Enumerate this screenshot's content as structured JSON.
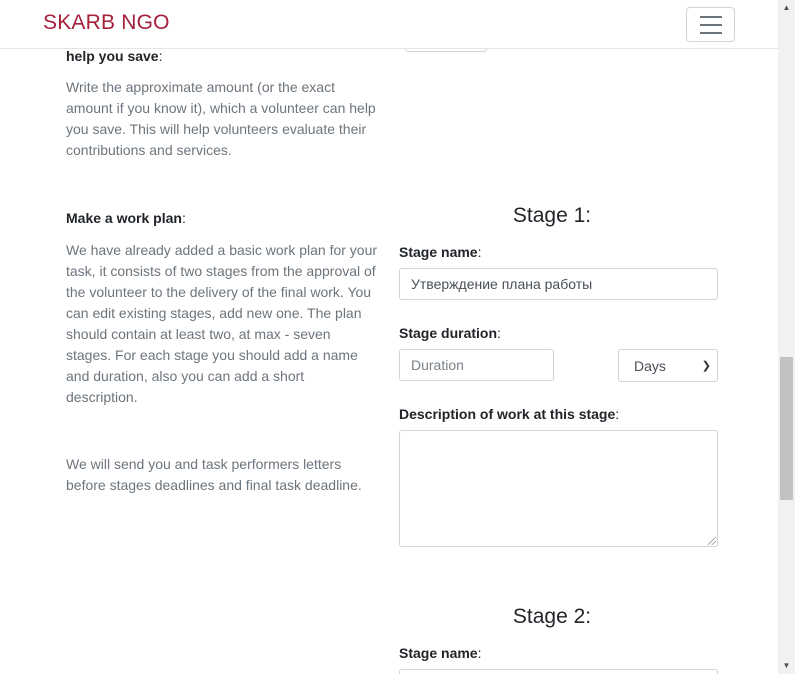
{
  "navbar": {
    "brand": "SKARB NGO",
    "toggle_icon": "hamburger-icon"
  },
  "save_section": {
    "label": "help you save",
    "label_colon": ":",
    "help": "Write the approximate amount (or the exact amount if you know it), which a volunteer can help you save. This will help volunteers evaluate their contributions and services."
  },
  "work_plan": {
    "label": "Make a work plan",
    "label_colon": ":",
    "help": "We have already added a basic work plan for your task, it consists of two stages from the approval of the volunteer to the delivery of the final work. You can edit existing stages, add new one. The plan should contain at least two, at max - seven stages. For each stage you should add a name and duration, also you can add a short description.",
    "note": "We will send you and task performers letters before stages deadlines and final task deadline."
  },
  "stages": [
    {
      "title": "Stage 1:",
      "name_label": "Stage name",
      "name_value": "Утверждение плана работы",
      "duration_label": "Stage duration",
      "duration_placeholder": "Duration",
      "unit_selected": "Days",
      "description_label": "Description of work at this stage",
      "description_value": ""
    },
    {
      "title": "Stage 2:",
      "name_label": "Stage name"
    }
  ],
  "colon": ":",
  "colors": {
    "brand": "#a6203c",
    "help_text": "#6c757d",
    "border": "#ced4da"
  }
}
